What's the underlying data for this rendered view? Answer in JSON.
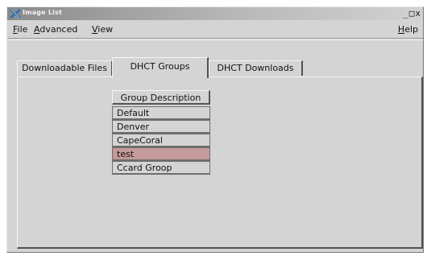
{
  "window": {
    "title": "Image List",
    "controls": {
      "minimize": "_",
      "maximize": "□",
      "close": "x"
    }
  },
  "menubar": {
    "items": [
      {
        "label": "File",
        "mnemonic": "F",
        "rest": "ile"
      },
      {
        "label": "Advanced",
        "mnemonic": "A",
        "rest": "dvanced"
      },
      {
        "label": "View",
        "mnemonic": "V",
        "rest": "iew"
      }
    ],
    "help": {
      "label": "Help",
      "mnemonic": "H",
      "rest": "elp"
    }
  },
  "tabs": [
    {
      "label": "Downloadable Files",
      "active": false
    },
    {
      "label": "DHCT Groups",
      "active": true
    },
    {
      "label": "DHCT Downloads",
      "active": false
    }
  ],
  "group_table": {
    "header": "Group Description",
    "rows": [
      {
        "label": "Default",
        "selected": false
      },
      {
        "label": "Denver",
        "selected": false
      },
      {
        "label": "CapeCoral",
        "selected": false
      },
      {
        "label": "test",
        "selected": true
      },
      {
        "label": "Ccard Groop",
        "selected": false
      }
    ]
  },
  "colors": {
    "window_bg": "#d4d4d4",
    "selected_row": "#c59a9a",
    "title_gradient_start": "#8a8a8a"
  }
}
